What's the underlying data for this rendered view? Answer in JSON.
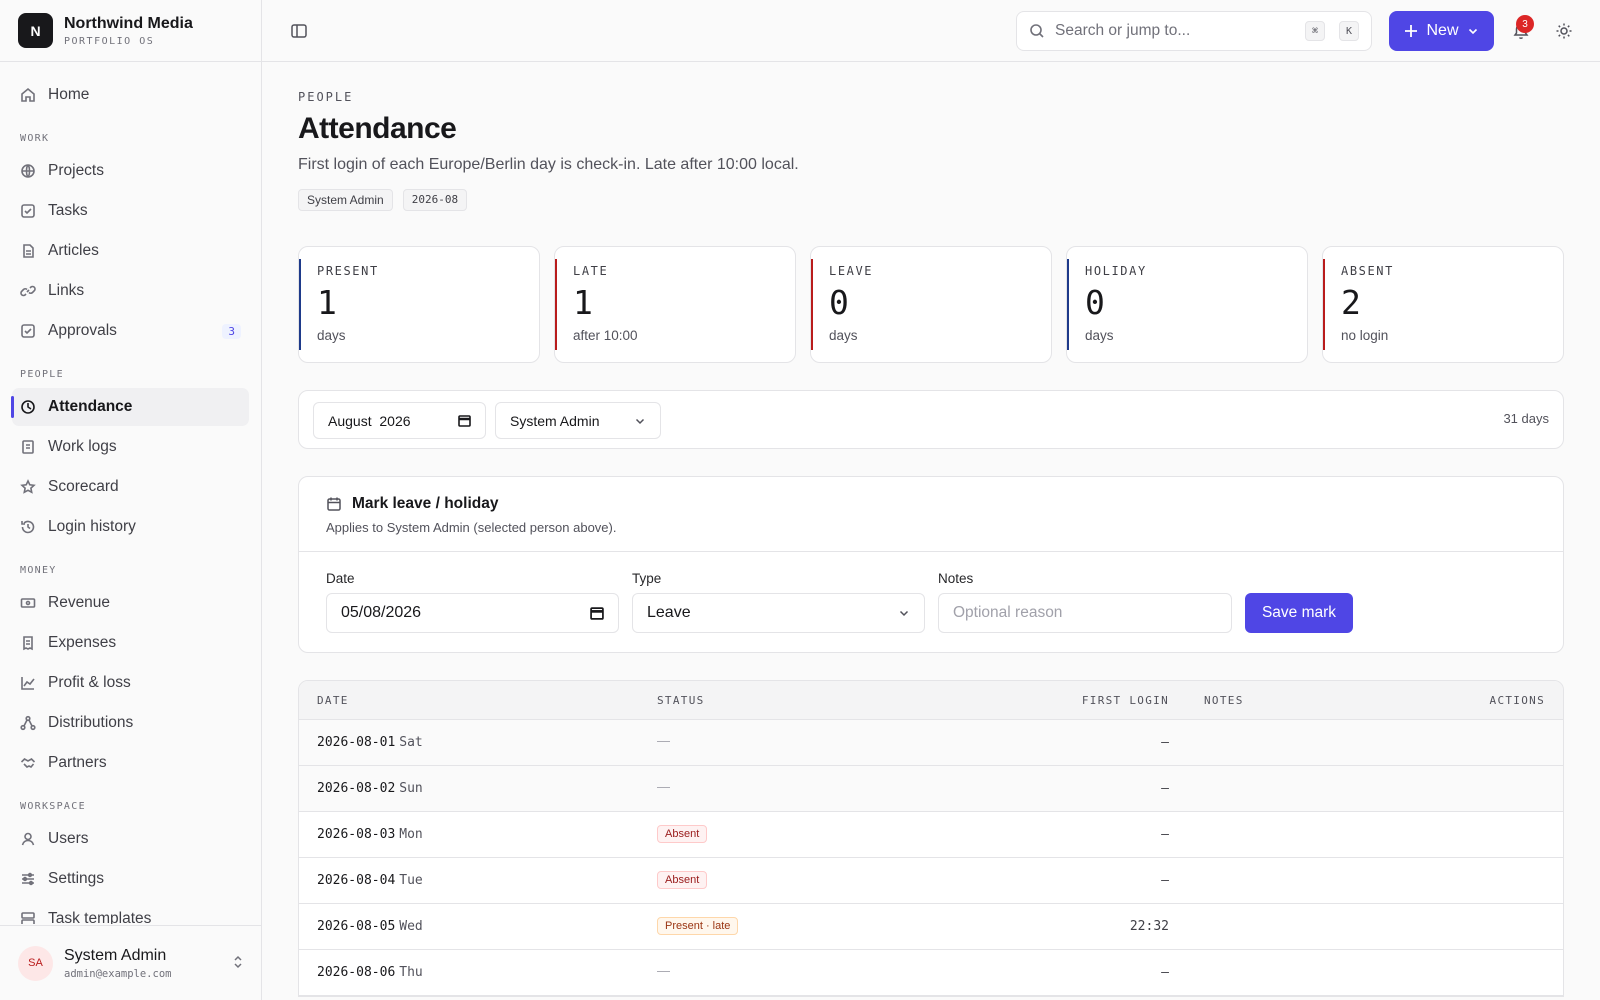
{
  "brand": {
    "initial": "N",
    "name": "Northwind Media",
    "subtitle": "PORTFOLIO OS"
  },
  "nav": {
    "home": "Home",
    "work_label": "WORK",
    "projects": "Projects",
    "tasks": "Tasks",
    "articles": "Articles",
    "links": "Links",
    "approvals": "Approvals",
    "approvals_count": "3",
    "people_label": "PEOPLE",
    "attendance": "Attendance",
    "work_logs": "Work logs",
    "scorecard": "Scorecard",
    "login_history": "Login history",
    "money_label": "MONEY",
    "revenue": "Revenue",
    "expenses": "Expenses",
    "profit_loss": "Profit & loss",
    "distributions": "Distributions",
    "partners": "Partners",
    "workspace_label": "WORKSPACE",
    "users": "Users",
    "settings": "Settings",
    "task_templates": "Task templates"
  },
  "user": {
    "initials": "SA",
    "name": "System Admin",
    "email": "admin@example.com"
  },
  "topbar": {
    "search_placeholder": "Search or jump to...",
    "kbd_cmd": "⌘",
    "kbd_k": "K",
    "new_label": "New",
    "notifications_count": "3"
  },
  "page": {
    "eyebrow": "PEOPLE",
    "title": "Attendance",
    "description": "First login of each Europe/Berlin day is check-in. Late after 10:00 local.",
    "tag_person": "System Admin",
    "tag_month": "2026-08"
  },
  "stats": [
    {
      "label": "PRESENT",
      "value": "1",
      "sub": "days"
    },
    {
      "label": "LATE",
      "value": "1",
      "sub": "after 10:00"
    },
    {
      "label": "LEAVE",
      "value": "0",
      "sub": "days"
    },
    {
      "label": "HOLIDAY",
      "value": "0",
      "sub": "days"
    },
    {
      "label": "ABSENT",
      "value": "2",
      "sub": "no login"
    }
  ],
  "filters": {
    "month": "August  2026",
    "person": "System Admin",
    "days_count": "31 days"
  },
  "mark": {
    "title": "Mark leave / holiday",
    "description": "Applies to System Admin (selected person above).",
    "date_label": "Date",
    "date_value": "05/08/2026",
    "type_label": "Type",
    "type_value": "Leave",
    "notes_label": "Notes",
    "notes_placeholder": "Optional reason",
    "save_label": "Save mark"
  },
  "table": {
    "headers": {
      "date": "DATE",
      "status": "STATUS",
      "first_login": "FIRST LOGIN",
      "notes": "NOTES",
      "actions": "ACTIONS"
    },
    "rows": [
      {
        "date": "2026-08-01",
        "dow": "Sat",
        "status": "—",
        "first_login": "—"
      },
      {
        "date": "2026-08-02",
        "dow": "Sun",
        "status": "—",
        "first_login": "—"
      },
      {
        "date": "2026-08-03",
        "dow": "Mon",
        "status": "Absent",
        "first_login": "—"
      },
      {
        "date": "2026-08-04",
        "dow": "Tue",
        "status": "Absent",
        "first_login": "—"
      },
      {
        "date": "2026-08-05",
        "dow": "Wed",
        "status": "Present · late",
        "first_login": "22:32"
      },
      {
        "date": "2026-08-06",
        "dow": "Thu",
        "status": "—",
        "first_login": "—"
      }
    ]
  }
}
